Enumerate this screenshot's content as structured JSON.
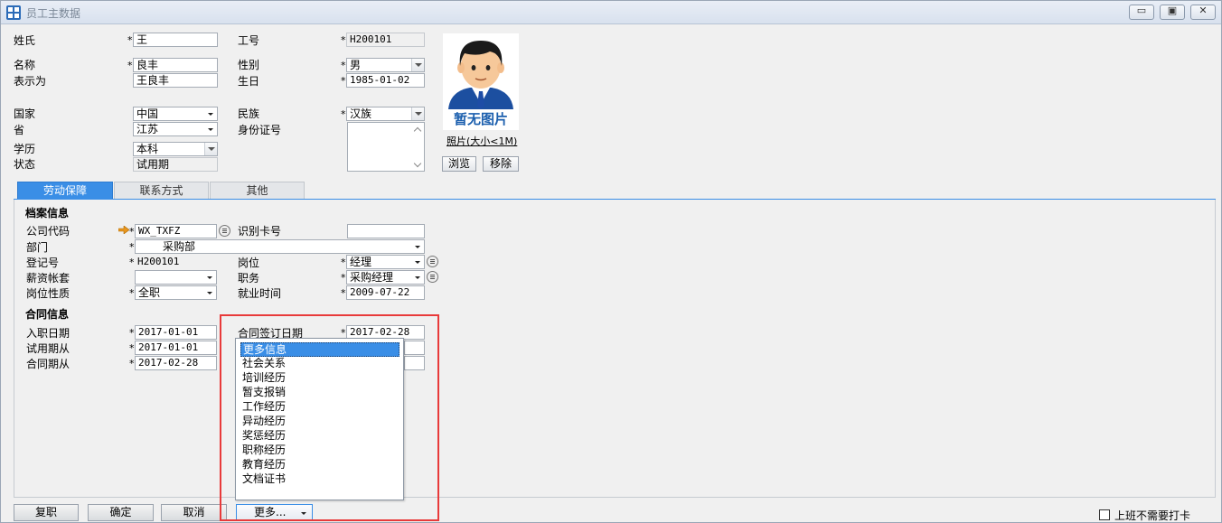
{
  "window": {
    "title": "员工主数据",
    "minimize": "▭",
    "maximize": "▣",
    "close": "✕"
  },
  "header": {
    "surname": {
      "label": "姓氏",
      "value": "王"
    },
    "emp_no": {
      "label": "工号",
      "value": "H200101"
    },
    "name": {
      "label": "名称",
      "value": "良丰"
    },
    "gender": {
      "label": "性别",
      "value": "男"
    },
    "display_as": {
      "label": "表示为",
      "value": "王良丰"
    },
    "birthday": {
      "label": "生日",
      "value": "1985-01-02"
    },
    "country": {
      "label": "国家",
      "value": "中国"
    },
    "ethnicity": {
      "label": "民族",
      "value": "汉族"
    },
    "province": {
      "label": "省",
      "value": "江苏"
    },
    "id_no": {
      "label": "身份证号",
      "value": ""
    },
    "education": {
      "label": "学历",
      "value": "本科"
    },
    "status": {
      "label": "状态",
      "value": "试用期"
    },
    "required_mark": "*"
  },
  "photo": {
    "placeholder_text": "暂无图片",
    "size_link": "照片(大小<1M)",
    "browse": "浏览",
    "remove": "移除"
  },
  "tabs": [
    {
      "label": "劳动保障",
      "active": true
    },
    {
      "label": "联系方式",
      "active": false
    },
    {
      "label": "其他",
      "active": false
    }
  ],
  "archive": {
    "title": "档案信息",
    "company_code": {
      "label": "公司代码",
      "value": "WX_TXFZ"
    },
    "id_card_no": {
      "label": "识别卡号",
      "value": ""
    },
    "department": {
      "label": "部门",
      "value": "采购部"
    },
    "reg_no": {
      "label": "登记号",
      "value": "H200101"
    },
    "post": {
      "label": "岗位",
      "value": "经理"
    },
    "salary_set": {
      "label": "薪资帐套",
      "value": ""
    },
    "duty": {
      "label": "职务",
      "value": "采购经理"
    },
    "post_nature": {
      "label": "岗位性质",
      "value": "全职"
    },
    "employ_time": {
      "label": "就业时间",
      "value": "2009-07-22"
    }
  },
  "contract": {
    "title": "合同信息",
    "entry_date": {
      "label": "入职日期",
      "value": "2017-01-01"
    },
    "sign_date": {
      "label": "合同签订日期",
      "value": "2017-02-28"
    },
    "probation_from": {
      "label": "试用期从",
      "value": "2017-01-01"
    },
    "contract_from": {
      "label": "合同期从",
      "value": "2017-02-28"
    }
  },
  "more_menu": {
    "items": [
      "更多信息",
      "社会关系",
      "培训经历",
      "暂支报销",
      "工作经历",
      "异动经历",
      "奖惩经历",
      "职称经历",
      "教育经历",
      "文档证书"
    ],
    "selected_index": 0
  },
  "footer": {
    "copy": "复职",
    "ok": "确定",
    "cancel": "取消",
    "more": "更多...",
    "no_clock_in": "上班不需要打卡"
  }
}
